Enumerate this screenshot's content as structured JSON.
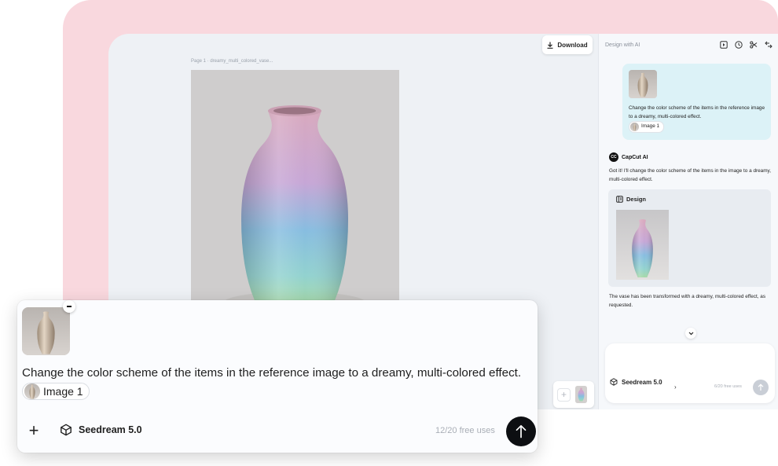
{
  "canvas": {
    "caption": "Page 1 ·   dreamy_multi_colored_vase...",
    "download_label": "Download"
  },
  "panel": {
    "title": "Design with AI",
    "header_icons": [
      "play-square-icon",
      "history-clock-icon",
      "scissors-icon",
      "expand-icon"
    ],
    "user_message": {
      "text": "Change the color scheme of the items in the reference image to a dreamy, multi-colored effect.",
      "attachment_label": "Image 1"
    },
    "assistant": {
      "name": "CapCut AI",
      "logo_text": "CC",
      "reply": "Got it! I'll change the color scheme of the items in the image to a dreamy, multi-colored effect.",
      "card_label": "Design",
      "followup": "The vase has been transformed with a dreamy, multi-colored effect, as requested."
    },
    "composer": {
      "model": "Seedream 5.0",
      "caret": "›",
      "free_uses": "6/20 free uses"
    }
  },
  "composer": {
    "prompt": "Change the color scheme of the items in the reference image to a dreamy, multi-colored effect.",
    "attachment_label": "Image 1",
    "add_label": "+",
    "model": "Seedream 5.0",
    "free_uses": "12/20 free uses"
  }
}
